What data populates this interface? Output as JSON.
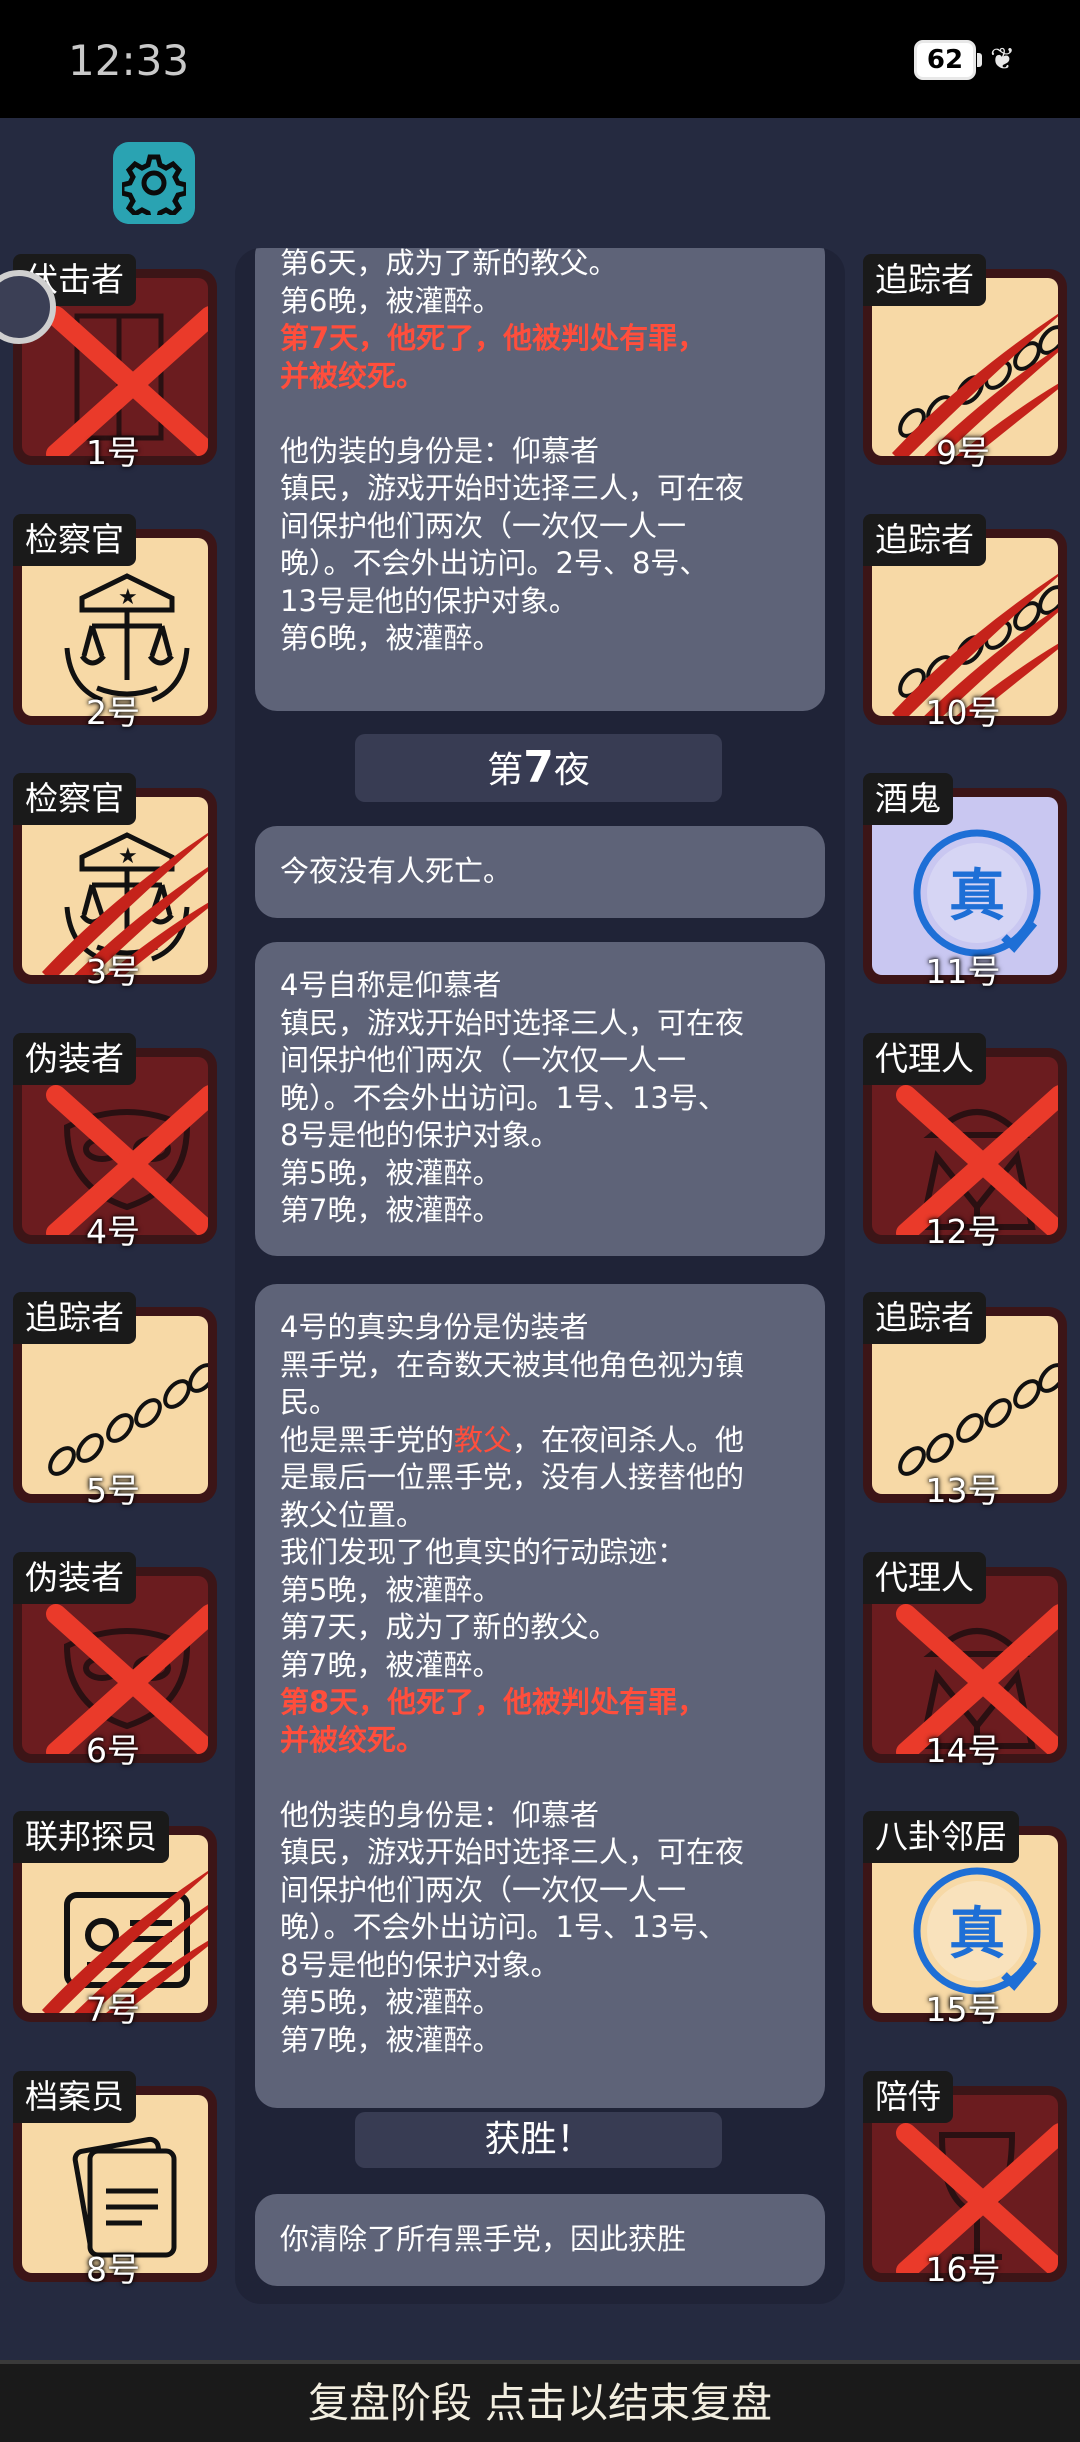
{
  "status_bar": {
    "time": "12:33",
    "battery": "62"
  },
  "settings_icon": "gear-icon",
  "log": {
    "card1_lines": [
      {
        "text": "第6天，成为了新的教父。",
        "red": false
      },
      {
        "text": "第6晚，被灌醉。",
        "red": false
      },
      {
        "text": "第7天，他死了，他被判处有罪，",
        "red": true
      },
      {
        "text": "并被绞死。",
        "red": true
      },
      {
        "text": "",
        "red": false
      },
      {
        "text": "他伪装的身份是：仰慕者",
        "red": false
      },
      {
        "text": "镇民，游戏开始时选择三人，可在夜",
        "red": false
      },
      {
        "text": "间保护他们两次（一次仅一人一",
        "red": false
      },
      {
        "text": "晚）。不会外出访问。2号、8号、",
        "red": false
      },
      {
        "text": "13号是他的保护对象。",
        "red": false
      },
      {
        "text": "第6晚，被灌醉。",
        "red": false
      }
    ],
    "night_header_prefix": "第",
    "night_header_num": "7",
    "night_header_suffix": "夜",
    "card2_text": "今夜没有人死亡。",
    "card3_lines": [
      "4号自称是仰慕者",
      "镇民，游戏开始时选择三人，可在夜",
      "间保护他们两次（一次仅一人一",
      "晚）。不会外出访问。1号、13号、",
      "8号是他的保护对象。",
      "第5晚，被灌醉。",
      "第7晚，被灌醉。"
    ],
    "card4": {
      "l1": "4号的真实身份是伪装者",
      "l2": "黑手党，在奇数天被其他角色视为镇",
      "l3": "民。",
      "l4a": "他是黑手党的",
      "l4b": "教父",
      "l4c": "，在夜间杀人。他",
      "l5": "是最后一位黑手党，没有人接替他的",
      "l6": "教父位置。",
      "l7": "我们发现了他真实的行动踪迹：",
      "l8": "第5晚，被灌醉。",
      "l9": "第7天，成为了新的教父。",
      "l10": "第7晚，被灌醉。",
      "l11": "第8天，他死了，他被判处有罪，",
      "l12": "并被绞死。",
      "l13": "他伪装的身份是：仰慕者",
      "l14": "镇民，游戏开始时选择三人，可在夜",
      "l15": "间保护他们两次（一次仅一人一",
      "l16": "晚）。不会外出访问。1号、13号、",
      "l17": "8号是他的保护对象。",
      "l18": "第5晚，被灌醉。",
      "l19": "第7晚，被灌醉。"
    },
    "victory_header": "获胜！",
    "card5_text": "你清除了所有黑手党，因此获胜"
  },
  "players_left": [
    {
      "role": "伏击者",
      "num": "1号",
      "icon": "door-icon",
      "state": "crossed"
    },
    {
      "role": "检察官",
      "num": "2号",
      "icon": "scales-icon",
      "state": "alive"
    },
    {
      "role": "检察官",
      "num": "3号",
      "icon": "scales-icon",
      "state": "clawed"
    },
    {
      "role": "伪装者",
      "num": "4号",
      "icon": "mask-icon",
      "state": "crossed"
    },
    {
      "role": "追踪者",
      "num": "5号",
      "icon": "footprints-icon",
      "state": "alive"
    },
    {
      "role": "伪装者",
      "num": "6号",
      "icon": "mask-icon",
      "state": "crossed"
    },
    {
      "role": "联邦探员",
      "num": "7号",
      "icon": "badge-icon",
      "state": "clawed"
    },
    {
      "role": "档案员",
      "num": "8号",
      "icon": "documents-icon",
      "state": "alive"
    }
  ],
  "players_right": [
    {
      "role": "追踪者",
      "num": "9号",
      "icon": "footprints-icon",
      "state": "clawed"
    },
    {
      "role": "追踪者",
      "num": "10号",
      "icon": "footprints-icon",
      "state": "clawed"
    },
    {
      "role": "酒鬼",
      "num": "11号",
      "icon": "truth-seal-icon",
      "state": "alive",
      "seal": "真"
    },
    {
      "role": "代理人",
      "num": "12号",
      "icon": "hat-coat-icon",
      "state": "crossed"
    },
    {
      "role": "追踪者",
      "num": "13号",
      "icon": "footprints-icon",
      "state": "alive"
    },
    {
      "role": "代理人",
      "num": "14号",
      "icon": "hat-coat-icon",
      "state": "crossed"
    },
    {
      "role": "八卦邻居",
      "num": "15号",
      "icon": "truth-seal-icon",
      "state": "alive",
      "seal": "真"
    },
    {
      "role": "陪侍",
      "num": "16号",
      "icon": "wine-glass-icon",
      "state": "crossed"
    }
  ],
  "bottom_bar": {
    "label": "复盘阶段 点击以结束复盘"
  },
  "colors": {
    "background": "#252a40",
    "card": "#5e6378",
    "highlight_red": "#ff4e3c",
    "tile_parchment": "#f7d9a6",
    "tile_dead": "#6b1c1f"
  }
}
